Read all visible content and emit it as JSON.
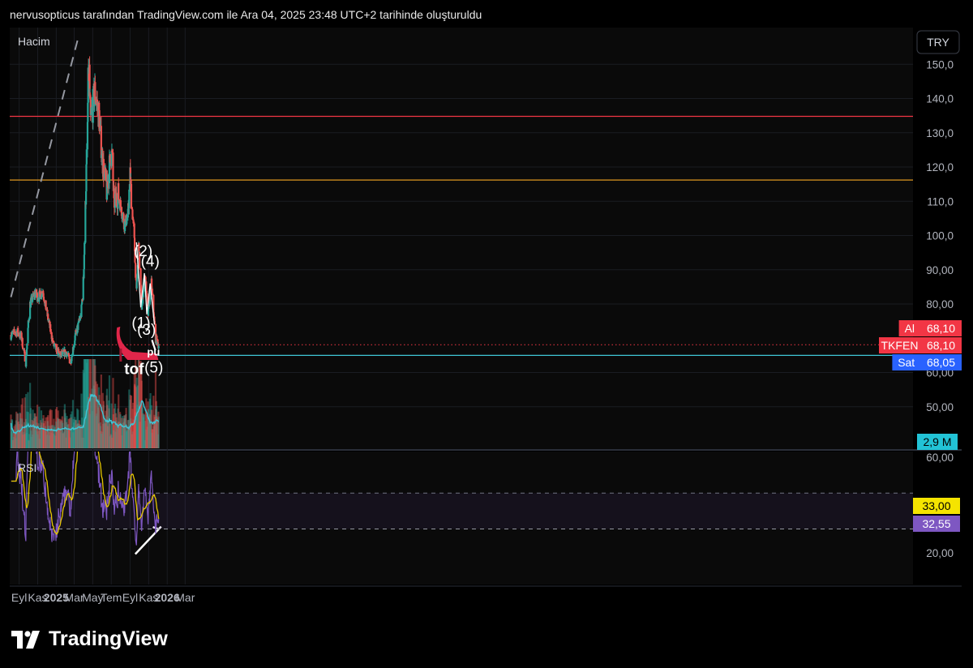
{
  "header": {
    "title": "nervusopticus tarafından TradingView.com ile Ara 04, 2025 23:48 UTC+2 tarihinde oluşturuldu"
  },
  "footer": {
    "logo_text": "TradingView"
  },
  "colors": {
    "up": "#26a69a",
    "down": "#ef5350",
    "red_line": "#f23645",
    "orange_line": "#f5a623",
    "cyan_line": "#3fc6d6",
    "rsi": "#7e57c2",
    "rsi_ma": "#e6c700",
    "sell_badge": "#2962ff"
  },
  "chart_data": [
    {
      "type": "candlestick",
      "panel": "price",
      "labels": {
        "volume": "Hacim",
        "currency": "TRY"
      },
      "ylim": [
        40,
        158
      ],
      "yticks": [
        "150,0",
        "140,0",
        "130,0",
        "120,0",
        "110,0",
        "100,0",
        "90,00",
        "80,00",
        "60,00",
        "50,00"
      ],
      "x_axis": [
        "Eyl",
        "Kas",
        "2025",
        "Mar",
        "May",
        "Tem",
        "Eyl",
        "Kas",
        "2026",
        "Mar"
      ],
      "price_path": [
        {
          "date": "2024-08-05",
          "price": 71
        },
        {
          "date": "2024-08-26",
          "price": 72
        },
        {
          "date": "2024-09-09",
          "price": 70
        },
        {
          "date": "2024-09-23",
          "price": 63
        },
        {
          "date": "2024-10-01",
          "price": 74
        },
        {
          "date": "2024-10-07",
          "price": 80
        },
        {
          "date": "2024-10-22",
          "price": 83
        },
        {
          "date": "2024-11-04",
          "price": 82
        },
        {
          "date": "2024-11-18",
          "price": 84
        },
        {
          "date": "2024-12-02",
          "price": 77
        },
        {
          "date": "2024-12-23",
          "price": 68
        },
        {
          "date": "2025-01-13",
          "price": 65
        },
        {
          "date": "2025-02-03",
          "price": 66
        },
        {
          "date": "2025-02-17",
          "price": 63
        },
        {
          "date": "2025-03-03",
          "price": 70
        },
        {
          "date": "2025-03-24",
          "price": 77
        },
        {
          "date": "2025-04-01",
          "price": 88
        },
        {
          "date": "2025-04-08",
          "price": 112
        },
        {
          "date": "2025-04-14",
          "price": 132
        },
        {
          "date": "2025-04-17",
          "price": 150
        },
        {
          "date": "2025-04-24",
          "price": 133
        },
        {
          "date": "2025-05-08",
          "price": 142
        },
        {
          "date": "2025-05-22",
          "price": 135
        },
        {
          "date": "2025-06-02",
          "price": 122
        },
        {
          "date": "2025-06-16",
          "price": 113
        },
        {
          "date": "2025-06-30",
          "price": 124
        },
        {
          "date": "2025-07-03",
          "price": 123
        },
        {
          "date": "2025-07-10",
          "price": 110
        },
        {
          "date": "2025-07-24",
          "price": 112
        },
        {
          "date": "2025-08-14",
          "price": 103
        },
        {
          "date": "2025-08-25",
          "price": 106
        },
        {
          "date": "2025-09-01",
          "price": 117
        },
        {
          "date": "2025-09-15",
          "price": 98
        },
        {
          "date": "2025-09-22",
          "price": 83
        },
        {
          "date": "2025-09-29",
          "price": 97
        },
        {
          "date": "2025-10-09",
          "price": 79
        },
        {
          "date": "2025-10-20",
          "price": 89
        },
        {
          "date": "2025-10-30",
          "price": 77
        },
        {
          "date": "2025-11-10",
          "price": 86
        },
        {
          "date": "2025-11-24",
          "price": 70
        },
        {
          "date": "2025-12-04",
          "price": 68.1
        }
      ],
      "horizontal_lines": [
        {
          "price": 134.8,
          "color": "#f23645"
        },
        {
          "price": 116.2,
          "color": "#f5a623"
        },
        {
          "price": 65.0,
          "color": "#3fc6d6"
        },
        {
          "price": 68.1,
          "color": "#f23645",
          "style": "dotted"
        }
      ],
      "trendline": {
        "from": {
          "date": "2024-08-05",
          "price": 82
        },
        "to": {
          "date": "2025-03-15",
          "price": 158
        },
        "style": "dashed"
      },
      "wave_labels": [
        {
          "text": "(1)",
          "date": "2025-10-07",
          "price": 73
        },
        {
          "text": "(2)",
          "date": "2025-10-14",
          "price": 94
        },
        {
          "text": "(3)",
          "date": "2025-10-25",
          "price": 71
        },
        {
          "text": "(4)",
          "date": "2025-11-06",
          "price": 91
        },
        {
          "text": "(5)",
          "date": "2025-11-18",
          "price": 60
        },
        {
          "text": "pu",
          "date": "2025-11-17",
          "price": 65
        },
        {
          "text": "tof",
          "date": "2025-09-14",
          "price": 59.5
        }
      ],
      "price_badges": [
        {
          "label": "Al",
          "value": "68,10",
          "color": "#f23645"
        },
        {
          "label": "TKFEN",
          "value": "68,10",
          "color": "#f23645"
        },
        {
          "label": "Sat",
          "value": "68,05",
          "color": "#2962ff"
        }
      ],
      "volume_badge": "2,9 M"
    },
    {
      "type": "line",
      "panel": "rsi",
      "title": "RSI",
      "ylim": [
        12,
        64
      ],
      "yticks": [
        "60,00",
        "20,00"
      ],
      "upper_band": 45,
      "lower_band": 30,
      "series": [
        {
          "name": "RSI",
          "value": "32,55"
        },
        {
          "name": "RSI MA",
          "value": "33,00"
        }
      ]
    }
  ]
}
